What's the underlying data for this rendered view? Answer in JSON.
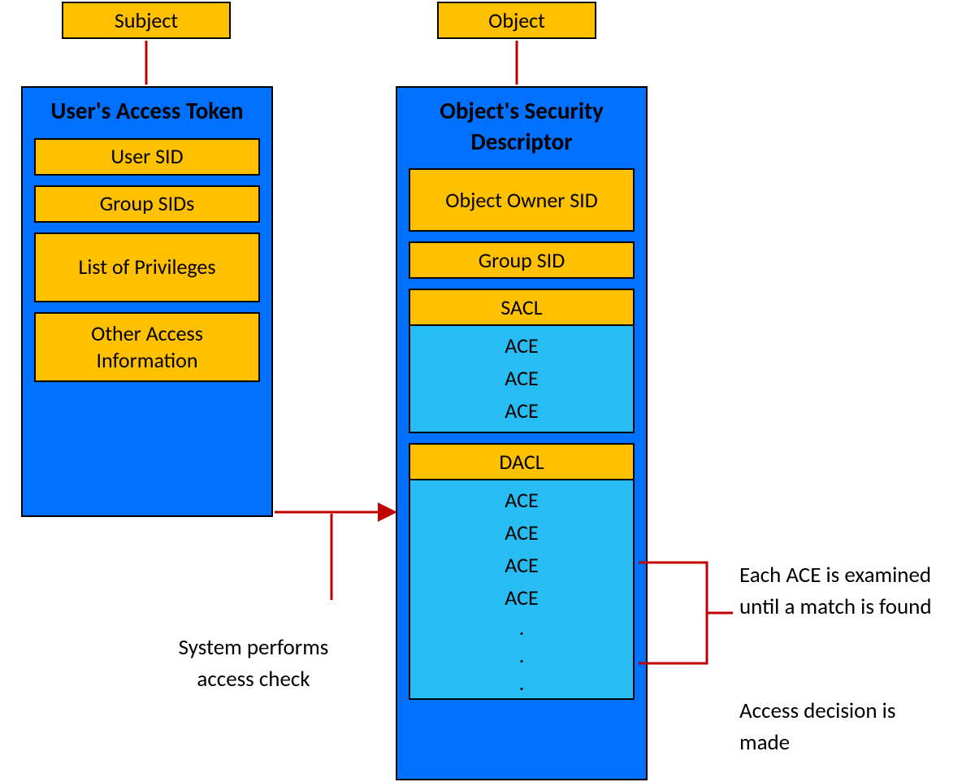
{
  "subject_label": "Subject",
  "object_label": "Object",
  "token": {
    "title": "User's Access Token",
    "rows": [
      "User SID",
      "Group SIDs",
      "List of Privileges",
      "Other Access Information"
    ]
  },
  "descriptor": {
    "title": "Object's Security Descriptor",
    "owner": "Object Owner SID",
    "group": "Group SID",
    "sacl": {
      "label": "SACL",
      "entries": [
        "ACE",
        "ACE",
        "ACE"
      ]
    },
    "dacl": {
      "label": "DACL",
      "entries": [
        "ACE",
        "ACE",
        "ACE",
        "ACE",
        ".",
        ".",
        "."
      ]
    }
  },
  "annotations": {
    "access_check": "System performs access check",
    "each_ace": "Each ACE is examined until a match is found",
    "decision": "Access decision is made"
  },
  "colors": {
    "orange": "#ffc000",
    "blue": "#0070ff",
    "light_blue": "#27bcf2",
    "line": "#c00000"
  }
}
